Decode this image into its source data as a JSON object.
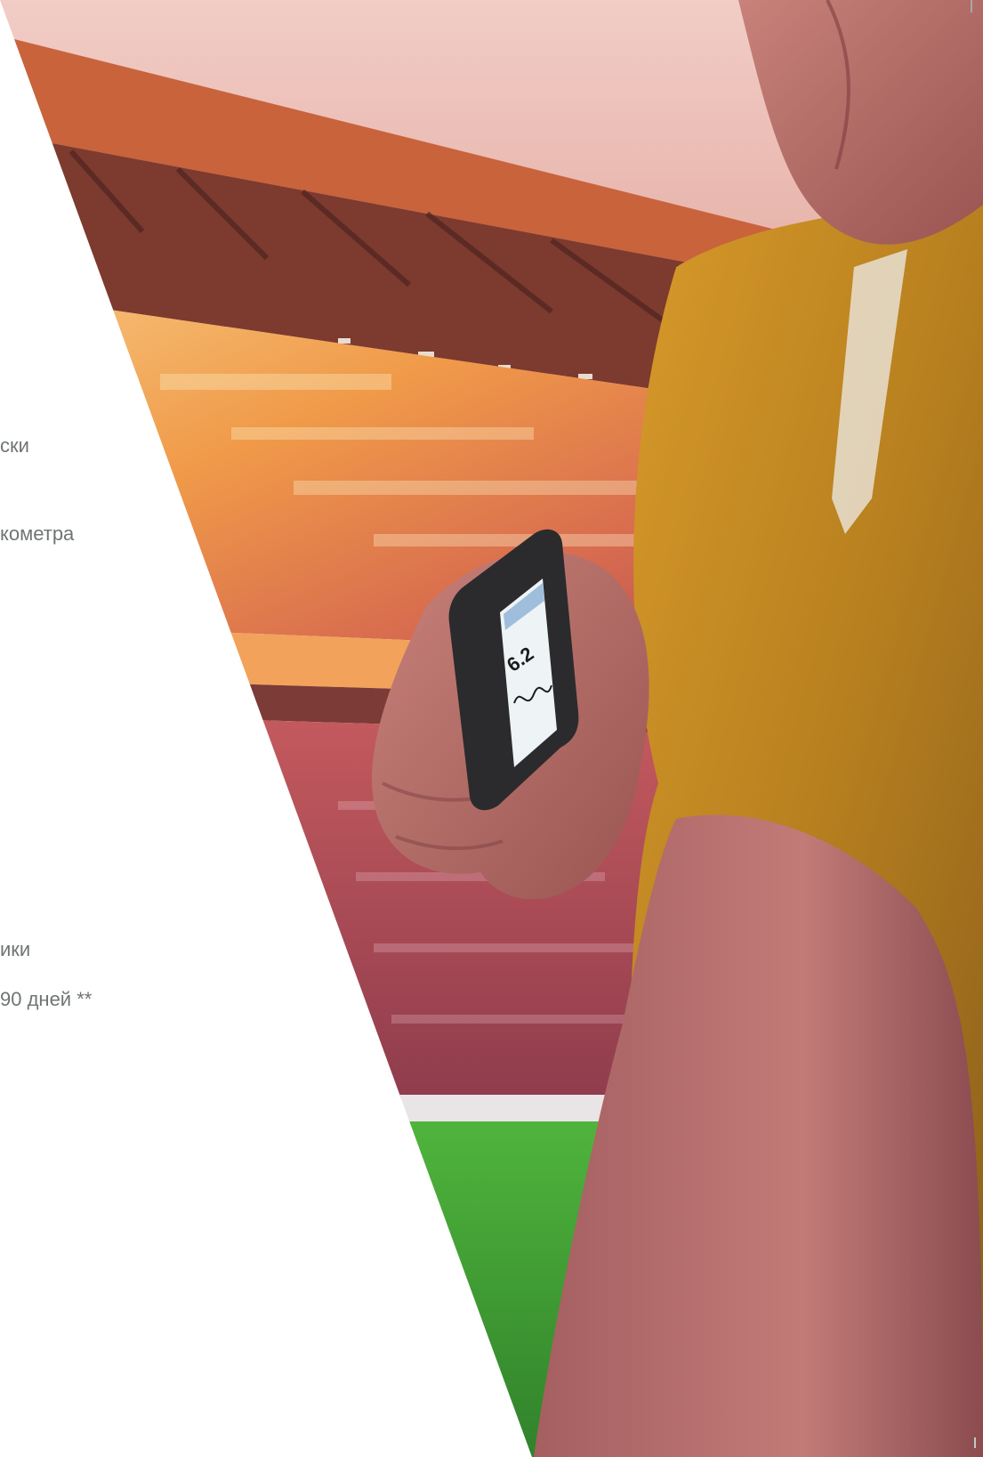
{
  "text_fragments": {
    "line_1": "ски",
    "line_2": "кометра",
    "line_3": "ики",
    "line_4": "90 дней **"
  },
  "photo": {
    "device_reading": "6.2"
  },
  "colors": {
    "text": "#6f7574",
    "sky": "#eab6b0",
    "roof": "#7d3a2f",
    "crowd": "#f19b3f",
    "grass": "#3c9e35",
    "shirt": "#c58a22",
    "skin": "#b96e66",
    "device": "#2b2b2d"
  }
}
